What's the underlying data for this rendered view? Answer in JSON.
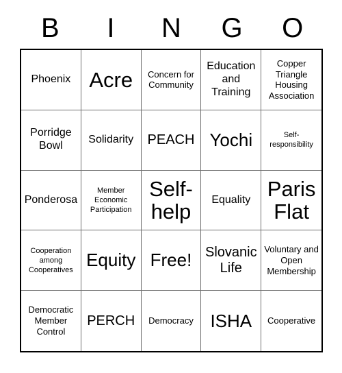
{
  "card": {
    "title": "BINGO",
    "header_letters": [
      "B",
      "I",
      "N",
      "G",
      "O"
    ],
    "rows": 5,
    "columns": 5,
    "colors": {
      "background": "#ffffff",
      "text": "#000000",
      "outer_border": "#000000",
      "inner_border": "#6f6f6f"
    },
    "cells": [
      {
        "text": "Phoenix",
        "size": "fs-m"
      },
      {
        "text": "Acre",
        "size": "fs-xxl"
      },
      {
        "text": "Concern for Community",
        "size": "fs-s"
      },
      {
        "text": "Education and Training",
        "size": "fs-m"
      },
      {
        "text": "Copper Triangle Housing Association",
        "size": "fs-s"
      },
      {
        "text": "Porridge Bowl",
        "size": "fs-m"
      },
      {
        "text": "Solidarity",
        "size": "fs-m"
      },
      {
        "text": "PEACH",
        "size": "fs-l"
      },
      {
        "text": "Yochi",
        "size": "fs-xl"
      },
      {
        "text": "Self-responsibility",
        "size": "fs-xs"
      },
      {
        "text": "Ponderosa",
        "size": "fs-m"
      },
      {
        "text": "Member Economic Participation",
        "size": "fs-xs"
      },
      {
        "text": "Self-help",
        "size": "fs-xxl"
      },
      {
        "text": "Equality",
        "size": "fs-m"
      },
      {
        "text": "Paris Flat",
        "size": "fs-xxl"
      },
      {
        "text": "Cooperation among Cooperatives",
        "size": "fs-xs"
      },
      {
        "text": "Equity",
        "size": "fs-xl"
      },
      {
        "text": "Free!",
        "size": "fs-xl"
      },
      {
        "text": "Slovanic Life",
        "size": "fs-l"
      },
      {
        "text": "Voluntary and Open Membership",
        "size": "fs-s"
      },
      {
        "text": "Democratic Member Control",
        "size": "fs-s"
      },
      {
        "text": "PERCH",
        "size": "fs-l"
      },
      {
        "text": "Democracy",
        "size": "fs-s"
      },
      {
        "text": "ISHA",
        "size": "fs-xl"
      },
      {
        "text": "Cooperative",
        "size": "fs-s"
      }
    ]
  }
}
